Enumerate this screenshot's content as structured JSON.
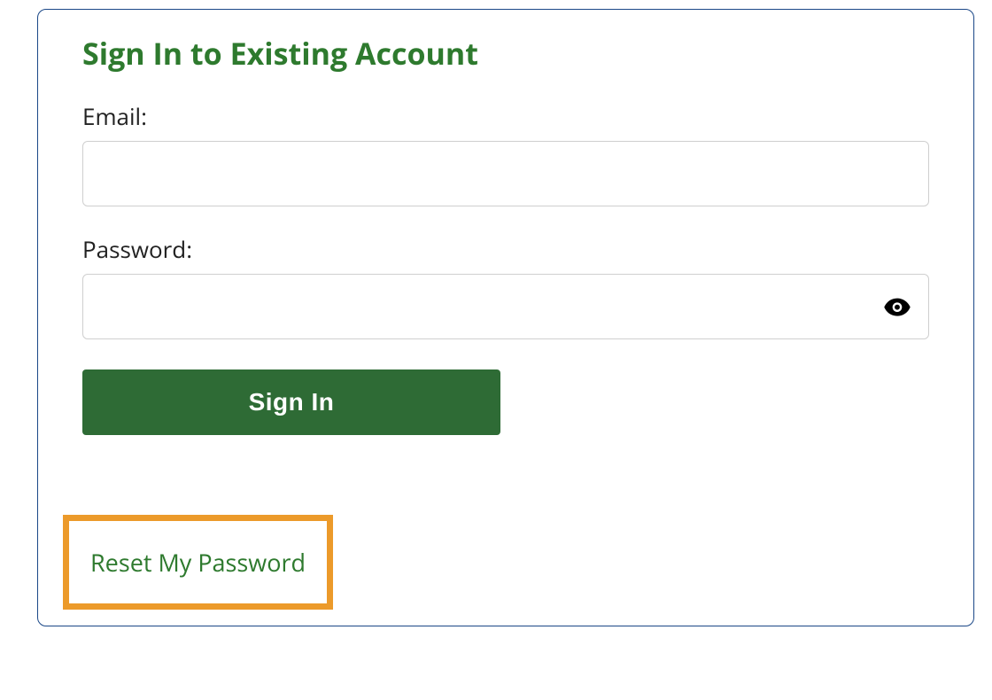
{
  "panel": {
    "title": "Sign In to Existing Account"
  },
  "form": {
    "email_label": "Email:",
    "email_value": "",
    "password_label": "Password:",
    "password_value": "",
    "signin_button_label": "Sign In"
  },
  "reset": {
    "link_text": "Reset My Password"
  },
  "icons": {
    "eye": "eye-icon"
  },
  "colors": {
    "title_green": "#2e7a2e",
    "button_green": "#2e6b35",
    "panel_border": "#1a4787",
    "highlight_orange": "#ec9a2a"
  }
}
